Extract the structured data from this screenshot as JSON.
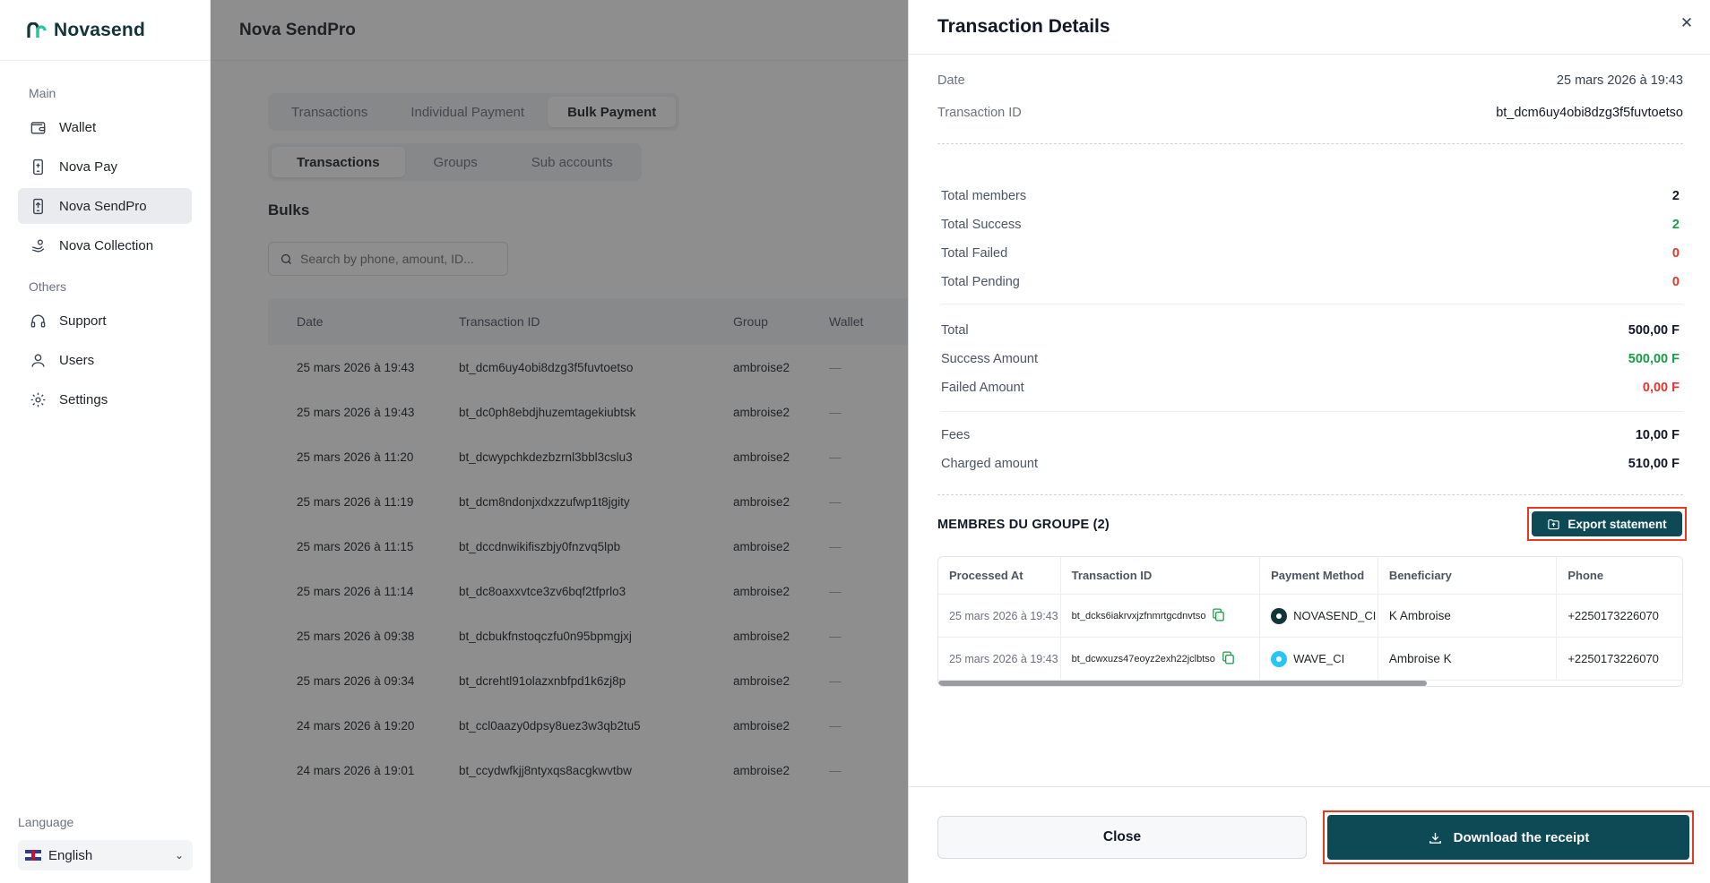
{
  "app": {
    "brand": "Novasend",
    "page_title": "Nova SendPro"
  },
  "sidebar": {
    "section_main": "Main",
    "section_others": "Others",
    "items": [
      {
        "label": "Wallet",
        "icon": "wallet-icon"
      },
      {
        "label": "Nova Pay",
        "icon": "phone-pay-icon"
      },
      {
        "label": "Nova SendPro",
        "icon": "phone-send-icon",
        "active": true
      },
      {
        "label": "Nova Collection",
        "icon": "collection-icon"
      }
    ],
    "other_items": [
      {
        "label": "Support",
        "icon": "headset-icon"
      },
      {
        "label": "Users",
        "icon": "user-icon"
      },
      {
        "label": "Settings",
        "icon": "gear-icon"
      }
    ],
    "language_label": "Language",
    "language_value": "English"
  },
  "main": {
    "tabs": [
      "Transactions",
      "Individual Payment",
      "Bulk Payment"
    ],
    "active_tab": "Bulk Payment",
    "subtabs": [
      "Transactions",
      "Groups",
      "Sub accounts"
    ],
    "active_subtab": "Transactions",
    "section_title": "Bulks",
    "search_placeholder": "Search by phone, amount, ID...",
    "table": {
      "headers": [
        "Date",
        "Transaction ID",
        "Group",
        "Wallet"
      ],
      "rows": [
        {
          "date": "25 mars 2026 à 19:43",
          "tid": "bt_dcm6uy4obi8dzg3f5fuvtoetso",
          "group": "ambroise2",
          "wallet": "—"
        },
        {
          "date": "25 mars 2026 à 19:43",
          "tid": "bt_dc0ph8ebdjhuzemtagekiubtsk",
          "group": "ambroise2",
          "wallet": "—"
        },
        {
          "date": "25 mars 2026 à 11:20",
          "tid": "bt_dcwypchkdezbzrnl3bbl3cslu3",
          "group": "ambroise2",
          "wallet": "—"
        },
        {
          "date": "25 mars 2026 à 11:19",
          "tid": "bt_dcm8ndonjxdxzzufwp1t8jgity",
          "group": "ambroise2",
          "wallet": "—"
        },
        {
          "date": "25 mars 2026 à 11:15",
          "tid": "bt_dccdnwikifiszbjy0fnzvq5lpb",
          "group": "ambroise2",
          "wallet": "—"
        },
        {
          "date": "25 mars 2026 à 11:14",
          "tid": "bt_dc8oaxxvtce3zv6bqf2tfprlo3",
          "group": "ambroise2",
          "wallet": "—"
        },
        {
          "date": "25 mars 2026 à 09:38",
          "tid": "bt_dcbukfnstoqczfu0n95bpmgjxj",
          "group": "ambroise2",
          "wallet": "—"
        },
        {
          "date": "25 mars 2026 à 09:34",
          "tid": "bt_dcrehtl91olazxnbfpd1k6zj8p",
          "group": "ambroise2",
          "wallet": "—"
        },
        {
          "date": "24 mars 2026 à 19:20",
          "tid": "bt_ccl0aazy0dpsy8uez3w3qb2tu5",
          "group": "ambroise2",
          "wallet": "—"
        },
        {
          "date": "24 mars 2026 à 19:01",
          "tid": "bt_ccydwfkjj8ntyxqs8acgkwvtbw",
          "group": "ambroise2",
          "wallet": "—"
        }
      ]
    }
  },
  "drawer": {
    "title": "Transaction Details",
    "close_glyph": "✕",
    "date_label": "Date",
    "date_value": "25 mars 2026 à 19:43",
    "tid_label": "Transaction ID",
    "tid_value": "bt_dcm6uy4obi8dzg3f5fuvtoetso",
    "summary": {
      "total_members_label": "Total members",
      "total_members": "2",
      "total_success_label": "Total Success",
      "total_success": "2",
      "total_failed_label": "Total Failed",
      "total_failed": "0",
      "total_pending_label": "Total Pending",
      "total_pending": "0",
      "total_label": "Total",
      "total": "500,00 F",
      "success_amount_label": "Success Amount",
      "success_amount": "500,00 F",
      "failed_amount_label": "Failed Amount",
      "failed_amount": "0,00 F",
      "fees_label": "Fees",
      "fees": "10,00 F",
      "charged_label": "Charged amount",
      "charged": "510,00 F"
    },
    "members_title": "MEMBRES DU GROUPE (2)",
    "export_label": "Export statement",
    "members_table": {
      "headers": [
        "Processed At",
        "Transaction ID",
        "Payment Method",
        "Beneficiary",
        "Phone"
      ],
      "rows": [
        {
          "processed_at": "25 mars 2026 à 19:43",
          "tid": "bt_dcks6iakrvxjzfnmrtgcdnvtso",
          "method": "NOVASEND_CI",
          "beneficiary": "K Ambroise",
          "phone": "+2250173226070"
        },
        {
          "processed_at": "25 mars 2026 à 19:43",
          "tid": "bt_dcwxuzs47eoyz2exh22jclbtso",
          "method": "WAVE_CI",
          "beneficiary": "Ambroise K",
          "phone": "+2250173226070"
        }
      ]
    },
    "close_label": "Close",
    "download_label": "Download the receipt"
  },
  "colors": {
    "brand_dark": "#0e4a55",
    "success": "#1a9c46",
    "danger": "#e5342c",
    "highlight": "#e23b22"
  }
}
